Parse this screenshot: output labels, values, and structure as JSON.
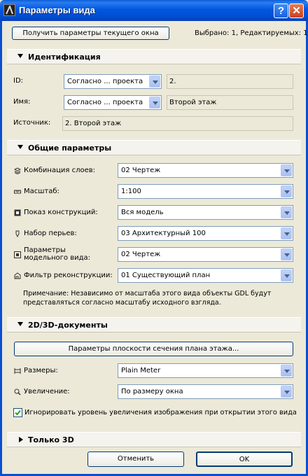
{
  "window": {
    "title": "Параметры вида"
  },
  "toolbar": {
    "get_params_label": "Получить параметры текущего окна",
    "selection_status": "Выбрано: 1, Редактируемых: 1"
  },
  "identification": {
    "section_title": "Идентификация",
    "id_label": "ID:",
    "id_select": "Согласно ... проекта",
    "id_value": "2.",
    "name_label": "Имя:",
    "name_select": "Согласно ... проекта",
    "name_value": "Второй этаж",
    "source_label": "Источник:",
    "source_value": "2. Второй этаж"
  },
  "general": {
    "section_title": "Общие параметры",
    "rows": [
      {
        "icon": "layers-icon",
        "label": "Комбинация слоев:",
        "value": "02 Чертеж"
      },
      {
        "icon": "scale-icon",
        "label": "Масштаб:",
        "value": "1:100"
      },
      {
        "icon": "structure-icon",
        "label": "Показ конструкций:",
        "value": "Вся модель"
      },
      {
        "icon": "pen-icon",
        "label": "Набор перьев:",
        "value": "03 Архитектурный 100"
      },
      {
        "icon": "model-view-icon",
        "label": "Параметры модельного вида:",
        "value": "02 Чертеж"
      },
      {
        "icon": "renovation-icon",
        "label": "Фильтр реконструкции:",
        "value": "01 Существующий план"
      }
    ],
    "note": "Примечание: Независимо от масштаба этого вида объекты GDL будут представляться согласно масштабу исходного взгляда."
  },
  "docs": {
    "section_title": "2D/3D-документы",
    "cut_plane_button": "Параметры плоскости сечения плана этажа...",
    "dimensions_label": "Размеры:",
    "dimensions_value": "Plain Meter",
    "zoom_label": "Увеличение:",
    "zoom_value": "По размеру окна",
    "ignore_zoom_label": "Игнорировать уровень увеличения изображения при открытии этого вида",
    "ignore_zoom_checked": true
  },
  "only3d": {
    "section_title": "Только 3D"
  },
  "footer": {
    "cancel_label": "Отменить",
    "ok_label": "OK"
  }
}
